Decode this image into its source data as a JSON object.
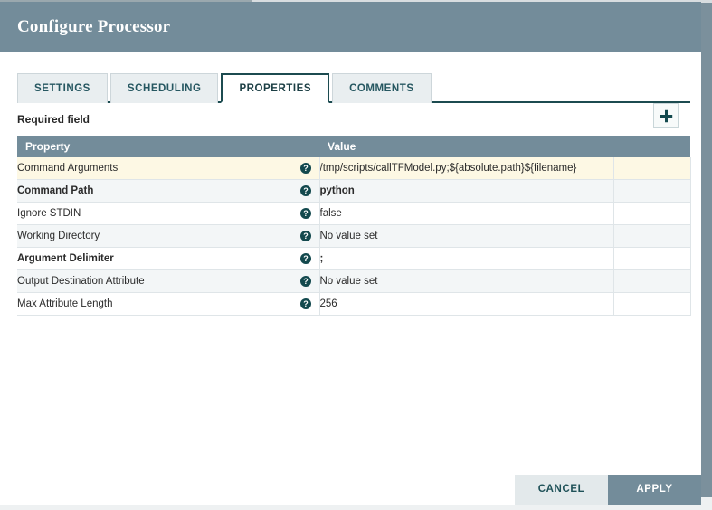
{
  "dialog": {
    "title": "Configure Processor"
  },
  "tabs": [
    {
      "label": "SETTINGS",
      "active": false
    },
    {
      "label": "SCHEDULING",
      "active": false
    },
    {
      "label": "PROPERTIES",
      "active": true
    },
    {
      "label": "COMMENTS",
      "active": false
    }
  ],
  "subheader": {
    "required_field_label": "Required field",
    "add_button_icon": "plus-icon"
  },
  "table": {
    "columns": [
      "Property",
      "Value"
    ],
    "help_icon": "question-mark-icon",
    "rows": [
      {
        "property": "Command Arguments",
        "value": "/tmp/scripts/callTFModel.py;${absolute.path}${filename}",
        "required": false,
        "empty": false,
        "selected": true
      },
      {
        "property": "Command Path",
        "value": "python",
        "required": true,
        "empty": false,
        "selected": false
      },
      {
        "property": "Ignore STDIN",
        "value": "false",
        "required": false,
        "empty": false,
        "selected": false
      },
      {
        "property": "Working Directory",
        "value": "No value set",
        "required": false,
        "empty": true,
        "selected": false
      },
      {
        "property": "Argument Delimiter",
        "value": ";",
        "required": true,
        "empty": false,
        "selected": false
      },
      {
        "property": "Output Destination Attribute",
        "value": "No value set",
        "required": false,
        "empty": true,
        "selected": false
      },
      {
        "property": "Max Attribute Length",
        "value": "256",
        "required": false,
        "empty": false,
        "selected": false
      }
    ]
  },
  "footer": {
    "cancel_label": "CANCEL",
    "apply_label": "APPLY"
  },
  "colors": {
    "header_slate": "#738c9a",
    "accent_teal": "#1c4b50",
    "selected_row": "#fdf8e4",
    "page_background": "#7b909c"
  }
}
